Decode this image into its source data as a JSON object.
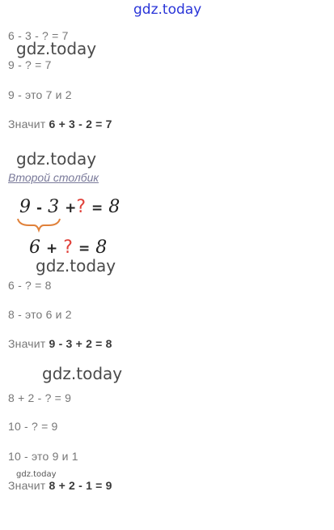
{
  "watermarks": {
    "top": "gdz.today",
    "w1": "gdz.today",
    "w2": "gdz.today",
    "w3": "gdz.today",
    "w4": "gdz.today",
    "small": "gdz.today"
  },
  "col1": {
    "lines": [
      "6 - 3 - ? = 7",
      "9 - ? = 7",
      "9 - это 7 и 2"
    ],
    "result_prefix": "Значит",
    "result_expr": "6 + 3 - 2 = 7"
  },
  "section2": {
    "title": "Второй столбик",
    "eq1": {
      "a": "9",
      "op1": "-",
      "b": "3",
      "op2": "+",
      "q": "?",
      "eq": "=",
      "r": "8"
    },
    "eq2": {
      "a": "6",
      "op1": "+",
      "q": "?",
      "eq": "=",
      "r": "8"
    },
    "lines": [
      "6 - ? = 8",
      "8 - это 6 и 2"
    ],
    "result_prefix": "Значит",
    "result_expr": "9 - 3 + 2 = 8"
  },
  "col3": {
    "lines": [
      "8 + 2 - ? = 9",
      "10 - ? = 9",
      "10 - это 9 и 1"
    ],
    "result_prefix": "Значит",
    "result_expr": "8 + 2 - 1 = 9"
  },
  "colors": {
    "question": "#e0413a",
    "brace": "#e0813a",
    "watermark_top": "#2a35d8"
  }
}
